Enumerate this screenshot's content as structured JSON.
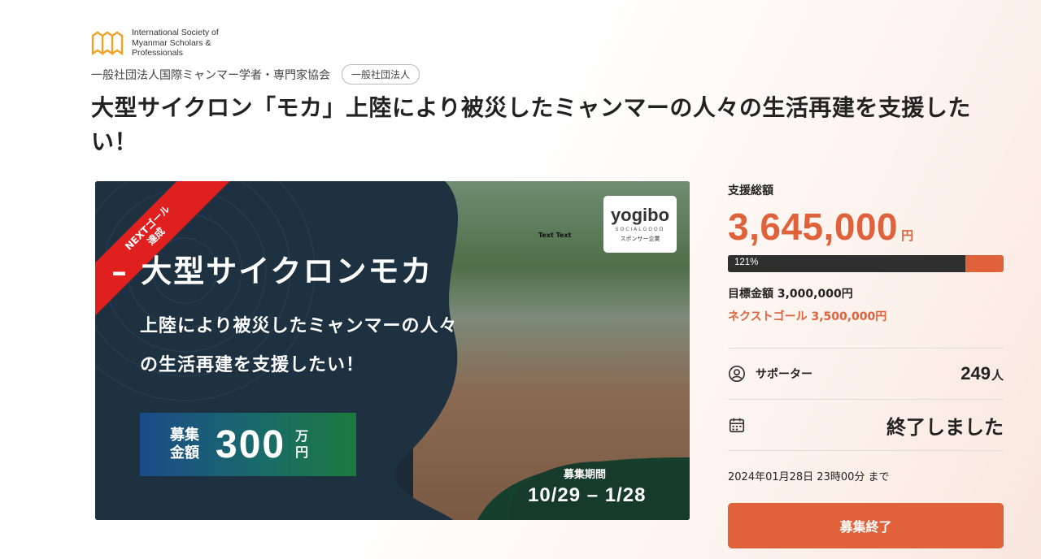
{
  "org": {
    "name_en": "International Society of Myanmar Scholars & Professionals",
    "name_ja": "一般社団法人国際ミャンマー学者・専門家協会",
    "badge": "一般社団法人"
  },
  "project": {
    "title": "大型サイクロン「モカ」上陸により被災したミャンマーの人々の生活再建を支援したい！"
  },
  "hero": {
    "ribbon_line1": "NEXTゴール",
    "ribbon_line2": "達成",
    "title": "– 大型サイクロンモカ",
    "subtitle_line1": "上陸により被災したミャンマーの人々",
    "subtitle_line2": "の生活再建を支援したい！",
    "goal_label": "募集金額",
    "goal_amount": "300",
    "goal_unit": "万円",
    "period_label": "募集期間",
    "period_dates": "10/29 – 1/28",
    "sponsor_brand": "yogibo",
    "sponsor_sub": "SOCIALGOOD",
    "sponsor_note": "スポンサー企業",
    "photo_text": "Text Text"
  },
  "stats": {
    "total_label": "支援総額",
    "total_amount": "3,645,000",
    "currency": "円",
    "progress_text": "121%",
    "progress_fraction": 0.86,
    "target": "目標金額 3,000,000円",
    "next_goal": "ネクストゴール 3,500,000円",
    "supporters_label": "サポーター",
    "supporters_count": "249",
    "supporters_unit": "人",
    "status": "終了しました",
    "deadline": "2024年01月28日 23時00分 まで",
    "end_button": "募集終了"
  },
  "colors": {
    "accent": "#e0623b",
    "progress_dark": "#2f2f2f",
    "ribbon": "#e0201f"
  }
}
